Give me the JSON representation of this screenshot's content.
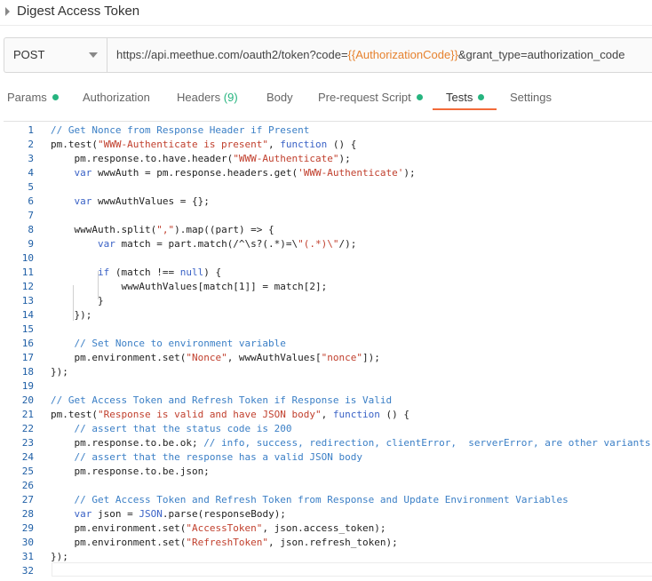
{
  "header": {
    "title": "Digest Access Token"
  },
  "request": {
    "method": "POST",
    "url_prefix": "https://api.meethue.com/oauth2/token?code=",
    "url_variable": "{{AuthorizationCode}}",
    "url_suffix": "&grant_type=authorization_code"
  },
  "tabs": {
    "params": "Params",
    "authorization": "Authorization",
    "headers": "Headers",
    "headers_count": "(9)",
    "body": "Body",
    "prerequest": "Pre-request Script",
    "tests": "Tests",
    "settings": "Settings"
  },
  "editor": {
    "line_numbers": [
      "1",
      "2",
      "3",
      "4",
      "5",
      "6",
      "7",
      "8",
      "9",
      "10",
      "11",
      "12",
      "13",
      "14",
      "15",
      "16",
      "17",
      "18",
      "19",
      "20",
      "21",
      "22",
      "23",
      "24",
      "25",
      "26",
      "27",
      "28",
      "29",
      "30",
      "31",
      "32"
    ],
    "lines": [
      "// Get Nonce from Response Header if Present",
      "pm.test(\"WWW-Authenticate is present\", function () {",
      "    pm.response.to.have.header(\"WWW-Authenticate\");",
      "    var wwwAuth = pm.response.headers.get('WWW-Authenticate');",
      "",
      "    var wwwAuthValues = {};",
      "",
      "    wwwAuth.split(\",\").map((part) => {",
      "        var match = part.match(/^\\s?(.*)=\\\"(.*)\\\"/);",
      "",
      "        if (match !== null) {",
      "            wwwAuthValues[match[1]] = match[2];",
      "        }",
      "    });",
      "",
      "    // Set Nonce to environment variable",
      "    pm.environment.set(\"Nonce\", wwwAuthValues[\"nonce\"]);",
      "});",
      "",
      "// Get Access Token and Refresh Token if Response is Valid",
      "pm.test(\"Response is valid and have JSON body\", function () {",
      "    // assert that the status code is 200",
      "    pm.response.to.be.ok; // info, success, redirection, clientError,  serverError, are other variants",
      "    // assert that the response has a valid JSON body",
      "    pm.response.to.be.json;",
      "",
      "    // Get Access Token and Refresh Token from Response and Update Environment Variables",
      "    var json = JSON.parse(responseBody);",
      "    pm.environment.set(\"AccessToken\", json.access_token);",
      "    pm.environment.set(\"RefreshToken\", json.refresh_token);",
      "});",
      ""
    ]
  },
  "colors": {
    "tab_dot": "#26b47f",
    "active_underline": "#f26b3a",
    "variable": "#e6822e",
    "comment": "#418bd6",
    "keyword": "#3a62c6",
    "string": "#c1402e",
    "line_number": "#1f5fa6"
  }
}
